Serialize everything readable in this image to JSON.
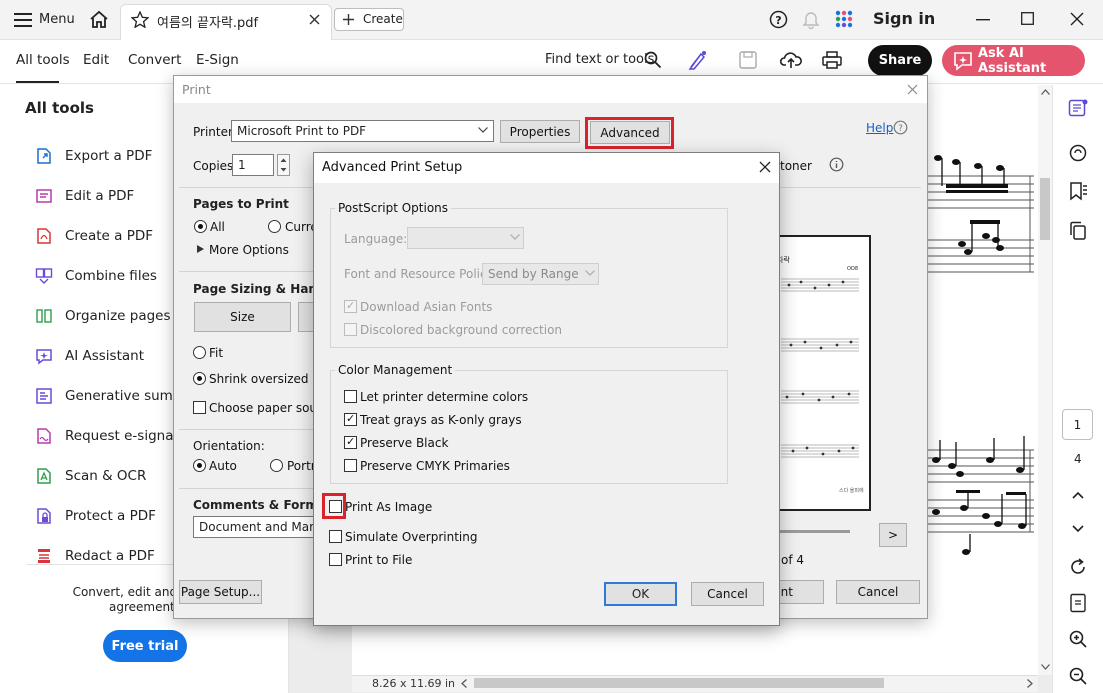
{
  "titlebar": {
    "menu_label": "Menu",
    "tab_title": "여름의 끝자락.pdf",
    "create_label": "Create",
    "sign_in": "Sign in"
  },
  "toolbar": {
    "tabs": [
      "All tools",
      "Edit",
      "Convert",
      "E-Sign"
    ],
    "find_label": "Find text or tools",
    "share_label": "Share",
    "ai_label": "Ask AI Assistant"
  },
  "left_panel": {
    "title": "All tools",
    "items": [
      {
        "label": "Export a PDF",
        "icon": "export-pdf-icon",
        "color": "#1b6fd0"
      },
      {
        "label": "Edit a PDF",
        "icon": "edit-pdf-icon",
        "color": "#b53bb0"
      },
      {
        "label": "Create a PDF",
        "icon": "create-pdf-icon",
        "color": "#d8353d"
      },
      {
        "label": "Combine files",
        "icon": "combine-files-icon",
        "color": "#6c4bd6"
      },
      {
        "label": "Organize pages",
        "icon": "organize-pages-icon",
        "color": "#2e9e4f"
      },
      {
        "label": "AI Assistant",
        "icon": "ai-assistant-icon",
        "color": "#6c4bd6"
      },
      {
        "label": "Generative summar",
        "icon": "generative-summary-icon",
        "color": "#6c4bd6"
      },
      {
        "label": "Request e-signature",
        "icon": "request-esignature-icon",
        "color": "#b53bb0"
      },
      {
        "label": "Scan & OCR",
        "icon": "scan-ocr-icon",
        "color": "#2e9e4f"
      },
      {
        "label": "Protect a PDF",
        "icon": "protect-pdf-icon",
        "color": "#6c4bd6"
      },
      {
        "label": "Redact a PDF",
        "icon": "redact-pdf-icon",
        "color": "#d8353d"
      }
    ],
    "promo_line1": "Convert, edit and e-sign",
    "promo_line2": "agreements",
    "free_trial": "Free trial"
  },
  "doc": {
    "page_size": "8.26 x 11.69 in"
  },
  "right_rail": {
    "current_page": "1",
    "total_pages": "4"
  },
  "print_dialog": {
    "title": "Print",
    "printer_label": "Printer:",
    "printer_value": "Microsoft Print to PDF",
    "properties_label": "Properties",
    "advanced_label": "Advanced",
    "help_label": "Help",
    "copies_label": "Copies:",
    "copies_value": "1",
    "toner_label": "toner",
    "pages_heading": "Pages to Print",
    "all_label": "All",
    "current_label": "Curre",
    "more_options": "More Options",
    "sizing_heading": "Page Sizing & Handling",
    "size_label": "Size",
    "fit_label": "Fit",
    "shrink_label": "Shrink oversized page",
    "choose_source_label": "Choose paper source",
    "orientation_heading": "Orientation:",
    "auto_label": "Auto",
    "portrait_label": "Portra",
    "comments_heading": "Comments & Forms",
    "comments_value": "Document and Markups",
    "page_of": "of 4",
    "next_label": ">",
    "page_setup_label": "Page Setup...",
    "print_label": "int",
    "cancel_label": "Cancel",
    "preview_title": "자락",
    "preview_composer": "OO8",
    "preview_footer": "스다 올피에"
  },
  "advanced_dialog": {
    "title": "Advanced Print Setup",
    "postscript_legend": "PostScript Options",
    "language_label": "Language:",
    "font_policy_label": "Font and Resource Policy:",
    "font_policy_value": "Send by Range",
    "download_fonts_label": "Download Asian Fonts",
    "discolored_label": "Discolored background correction",
    "color_legend": "Color Management",
    "let_printer_label": "Let printer determine colors",
    "treat_grays_label": "Treat grays as K-only grays",
    "preserve_black_label": "Preserve Black",
    "preserve_cmyk_label": "Preserve CMYK Primaries",
    "print_as_image_label": "Print As Image",
    "simulate_label": "Simulate Overprinting",
    "print_to_file_label": "Print to File",
    "ok_label": "OK",
    "cancel_label": "Cancel",
    "check_mark": "✓"
  }
}
